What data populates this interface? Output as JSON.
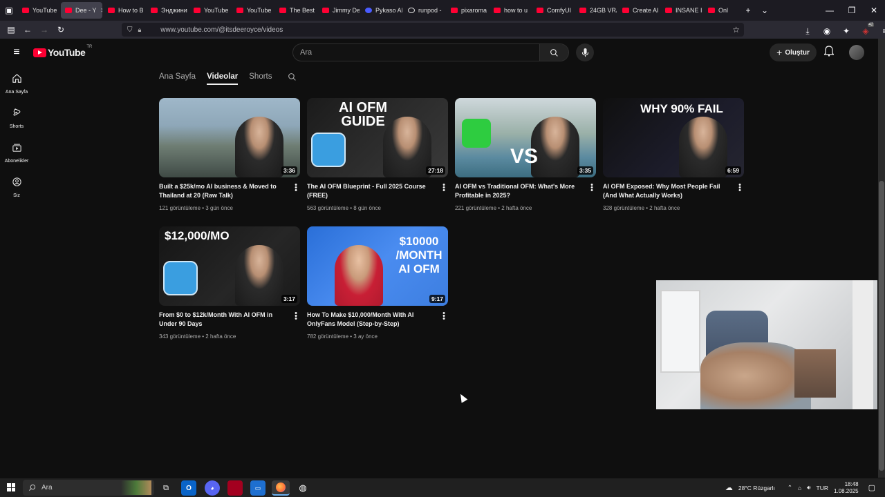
{
  "browser": {
    "tabs": [
      {
        "label": "YouTube",
        "active": false
      },
      {
        "label": "Dee - Y",
        "active": true
      },
      {
        "label": "How to B",
        "active": false
      },
      {
        "label": "Энджини",
        "active": false
      },
      {
        "label": "YouTube",
        "active": false
      },
      {
        "label": "YouTube",
        "active": false
      },
      {
        "label": "The Best",
        "active": false
      },
      {
        "label": "Jimmy De",
        "active": false
      },
      {
        "label": "Pykaso AI",
        "active": false
      },
      {
        "label": "runpod -",
        "active": false
      },
      {
        "label": "pixaroma",
        "active": false
      },
      {
        "label": "how to u",
        "active": false
      },
      {
        "label": "ComfyUI",
        "active": false
      },
      {
        "label": "24GB VRA",
        "active": false
      },
      {
        "label": "Create AI",
        "active": false
      },
      {
        "label": "INSANE I",
        "active": false
      },
      {
        "label": "Onl",
        "active": false
      }
    ],
    "url": "www.youtube.com/@itsdeeroyce/videos",
    "extension_badge": "42"
  },
  "youtube": {
    "logo_text": "YouTube",
    "region": "TR",
    "search_placeholder": "Ara",
    "create_label": "Oluştur",
    "sidebar": [
      {
        "label": "Ana Sayfa",
        "icon": "home-icon"
      },
      {
        "label": "Shorts",
        "icon": "shorts-icon"
      },
      {
        "label": "Abonelikler",
        "icon": "subscriptions-icon"
      },
      {
        "label": "Siz",
        "icon": "you-icon"
      }
    ],
    "channel_tabs": [
      {
        "label": "Ana Sayfa",
        "active": false
      },
      {
        "label": "Videolar",
        "active": true
      },
      {
        "label": "Shorts",
        "active": false
      }
    ],
    "videos": [
      {
        "title": "Built a $25k/mo AI business & Moved to Thailand at 20 (Raw Talk)",
        "views": "121 görüntüleme",
        "age": "3 gün önce",
        "duration": "3:36",
        "thumb_text": ""
      },
      {
        "title": "The AI OFM Blueprint - Full 2025 Course (FREE)",
        "views": "563 görüntüleme",
        "age": "8 gün önce",
        "duration": "27:18",
        "thumb_text": "AI OFM GUIDE"
      },
      {
        "title": "AI OFM vs Traditional OFM: What's More Profitable in 2025?",
        "views": "221 görüntüleme",
        "age": "2 hafta önce",
        "duration": "3:35",
        "thumb_text": "VS"
      },
      {
        "title": "AI OFM Exposed: Why Most People Fail (And What Actually Works)",
        "views": "328 görüntüleme",
        "age": "2 hafta önce",
        "duration": "6:59",
        "thumb_text": "WHY 90% FAIL"
      },
      {
        "title": "From $0 to $12k/Month With AI OFM in Under 90 Days",
        "views": "343 görüntüleme",
        "age": "2 hafta önce",
        "duration": "3:17",
        "thumb_text": "$12,000/MO"
      },
      {
        "title": "How To Make $10,000/Month With AI OnlyFans Model (Step-by-Step)",
        "views": "782 görüntüleme",
        "age": "3 ay önce",
        "duration": "9:17",
        "thumb_text": "$10000 /MONTH AI OFM"
      }
    ]
  },
  "taskbar": {
    "search_placeholder": "Ara",
    "weather": "28°C  Rüzgarlı",
    "language": "TUR",
    "time": "18:48",
    "date": "1.08.2025"
  },
  "colors": {
    "accent": "#ff0033",
    "bg": "#0f0f0f",
    "secondary_text": "#aaaaaa"
  }
}
